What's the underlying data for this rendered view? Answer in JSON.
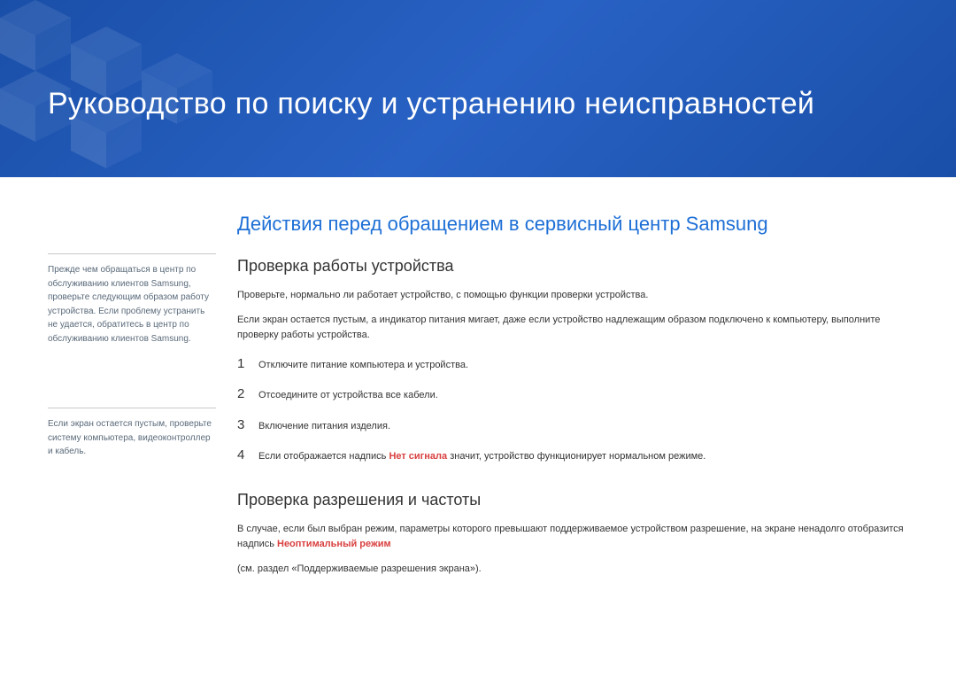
{
  "header": {
    "title": "Руководство по поиску и устранению неисправностей"
  },
  "sidebar": {
    "note1": "Прежде чем обращаться в центр по обслуживанию клиентов Samsung, проверьте следующим образом работу устройства. Если проблему устранить не удается, обратитесь в центр по обслуживанию клиентов Samsung.",
    "note2": "Если экран остается пустым, проверьте систему компьютера, видеоконтроллер и кабель."
  },
  "main": {
    "sectionTitle": "Действия перед обращением в сервисный центр Samsung",
    "sub1": {
      "title": "Проверка работы устройства",
      "p1": "Проверьте, нормально ли работает устройство, с помощью функции проверки устройства.",
      "p2": "Если экран остается пустым, а индикатор питания мигает, даже если устройство надлежащим образом подключено к компьютеру, выполните проверку работы устройства.",
      "steps": [
        {
          "n": "1",
          "text": "Отключите питание компьютера и устройства."
        },
        {
          "n": "2",
          "text": "Отсоедините от устройства все кабели."
        },
        {
          "n": "3",
          "text": "Включение питания изделия."
        },
        {
          "n": "4",
          "textBefore": "Если отображается надпись ",
          "highlight": "Нет сигнала",
          "textAfter": " значит, устройство функционирует нормальном режиме."
        }
      ]
    },
    "sub2": {
      "title": "Проверка разрешения и частоты",
      "p1Before": "В случае, если был выбран режим, параметры которого превышают поддерживаемое устройством разрешение, на экране ненадолго отобразится надпись ",
      "p1Highlight": "Неоптимальный режим",
      "p2": "(см. раздел «Поддерживаемые разрешения экрана»)."
    }
  }
}
